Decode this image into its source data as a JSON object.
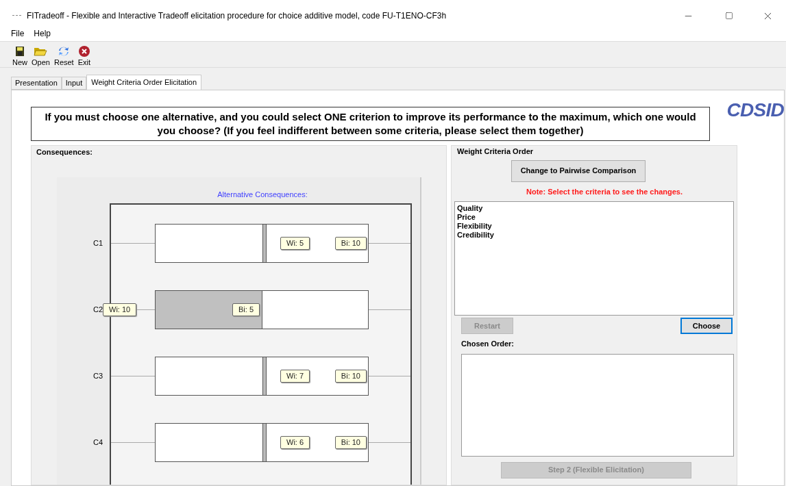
{
  "window": {
    "title": "FITradeoff - Flexible and Interactive Tradeoff elicitation  procedure for choice additive model, code FU-T1ENO-CF3h"
  },
  "menu": [
    "File",
    "Help"
  ],
  "toolbar": [
    {
      "label": "New",
      "kind": "new"
    },
    {
      "label": "Open",
      "kind": "open"
    },
    {
      "label": "Reset",
      "kind": "reset"
    },
    {
      "label": "Exit",
      "kind": "exit"
    }
  ],
  "tabs": [
    {
      "label": "Presentation",
      "selected": false
    },
    {
      "label": "Input",
      "selected": false
    },
    {
      "label": "Weight Criteria Order Elicitation",
      "selected": true
    }
  ],
  "logo": "CDSID",
  "question": "If you must choose one alternative, and you could select ONE criterion to improve its performance to the maximum, which one would you choose? (If you feel indifferent between some criteria, please select them together)",
  "consequences": {
    "title": "Consequences:",
    "chart_title": "Alternative Consequences:",
    "rows": [
      {
        "label": "C1",
        "wi": "Wi: 5",
        "bi": "Bi: 10",
        "kind": "split"
      },
      {
        "label": "C2",
        "wi": "Wi: 10",
        "bi": "Bi: 5",
        "kind": "filled"
      },
      {
        "label": "C3",
        "wi": "Wi: 7",
        "bi": "Bi: 10",
        "kind": "split"
      },
      {
        "label": "C4",
        "wi": "Wi: 6",
        "bi": "Bi: 10",
        "kind": "split"
      }
    ]
  },
  "order_panel": {
    "title": "Weight Criteria Order",
    "pairwise_button": "Change to Pairwise Comparison",
    "note": "Note: Select the criteria to see the changes.",
    "criteria": [
      {
        "label": "Quality",
        "selected": false
      },
      {
        "label": "Price",
        "selected": false
      },
      {
        "label": "Flexibility",
        "selected": false
      },
      {
        "label": "Credibility",
        "selected": false
      }
    ],
    "restart": {
      "label": "Restart",
      "disabled": true
    },
    "choose": {
      "label": "Choose",
      "disabled": false
    },
    "chosen_title": "Chosen Order:",
    "step2": {
      "label": "Step 2 (Flexible Elicitation)",
      "disabled": true
    }
  }
}
